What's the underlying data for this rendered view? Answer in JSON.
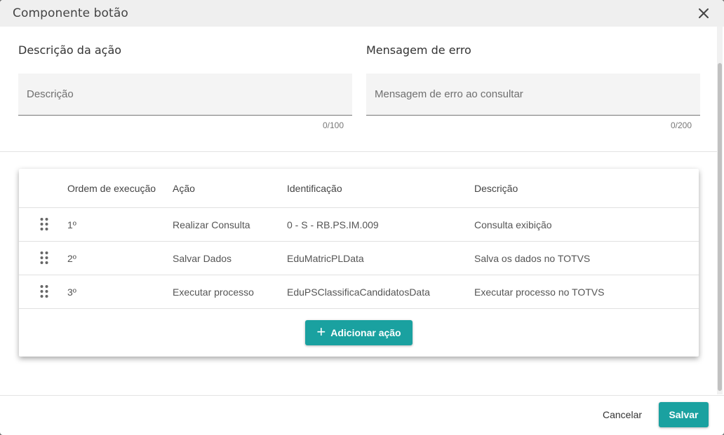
{
  "dialog": {
    "title": "Componente botão",
    "close_icon": "close-icon"
  },
  "form": {
    "description": {
      "label": "Descrição da ação",
      "placeholder": "Descrição",
      "value": "",
      "counter": "0/100"
    },
    "error_message": {
      "label": "Mensagem de erro",
      "placeholder": "Mensagem de erro ao consultar",
      "value": "",
      "counter": "0/200"
    }
  },
  "table": {
    "columns": [
      "Ordem de execução",
      "Ação",
      "Identificação",
      "Descrição"
    ],
    "rows": [
      {
        "order": "1º",
        "action": "Realizar Consulta",
        "identification": "0 - S - RB.PS.IM.009",
        "description": "Consulta exibição"
      },
      {
        "order": "2º",
        "action": "Salvar Dados",
        "identification": "EduMatricPLData",
        "description": "Salva os dados no TOTVS"
      },
      {
        "order": "3º",
        "action": "Executar processo",
        "identification": "EduPSClassificaCandidatosData",
        "description": "Executar processo no TOTVS"
      }
    ],
    "add_button": {
      "label": "Adicionar ação",
      "icon": "plus-icon"
    }
  },
  "footer": {
    "cancel_label": "Cancelar",
    "save_label": "Salvar"
  },
  "colors": {
    "accent": "#1aa1a0",
    "titlebar": "#efefef",
    "field_bg": "#f4f4f4"
  }
}
